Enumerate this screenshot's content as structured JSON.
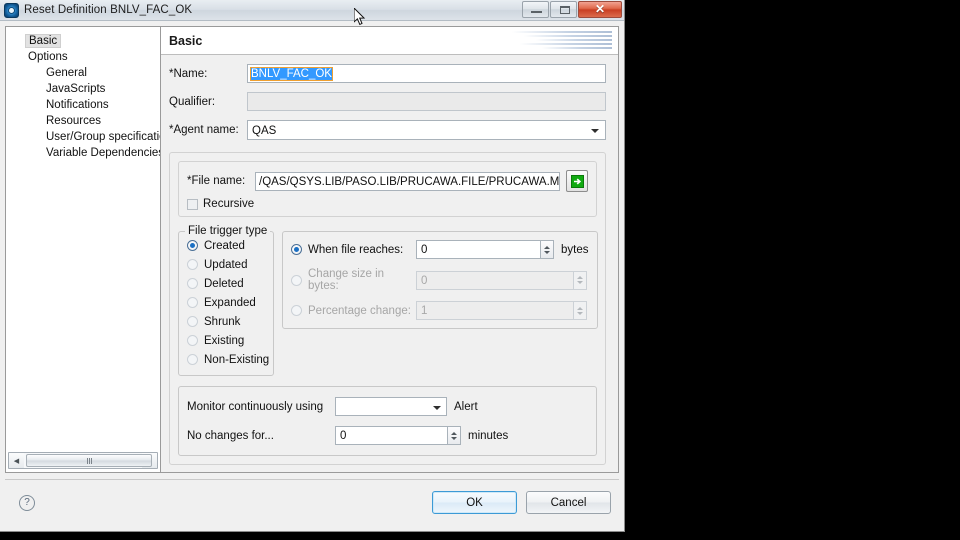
{
  "window": {
    "title": "Reset Definition BNLV_FAC_OK",
    "icon": "app-gear-icon",
    "minimize_label": "—",
    "maximize_label": "",
    "close_label": "✕"
  },
  "tree": {
    "items": [
      {
        "label": "Basic",
        "level": 0,
        "selected": true
      },
      {
        "label": "Options",
        "level": 0,
        "selected": false
      },
      {
        "label": "General",
        "level": 1,
        "selected": false
      },
      {
        "label": "JavaScripts",
        "level": 1,
        "selected": false
      },
      {
        "label": "Notifications",
        "level": 1,
        "selected": false
      },
      {
        "label": "Resources",
        "level": 1,
        "selected": false
      },
      {
        "label": "User/Group specificatio",
        "level": 1,
        "selected": false
      },
      {
        "label": "Variable Dependencies",
        "level": 1,
        "selected": false
      }
    ],
    "scrollbar": {
      "left_arrow": "◀",
      "right_arrow": "▶"
    }
  },
  "page": {
    "title": "Basic"
  },
  "form": {
    "name_label": "*Name:",
    "name_value": "BNLV_FAC_OK",
    "qualifier_label": "Qualifier:",
    "qualifier_value": "",
    "agent_label": "*Agent name:",
    "agent_value": "QAS"
  },
  "file_section": {
    "file_label": "*File name:",
    "file_value": "/QAS/QSYS.LIB/PASO.LIB/PRUCAWA.FILE/PRUCAWA.MBR",
    "browse_icon": "open-arrow-icon",
    "recursive_label": "Recursive",
    "recursive_checked": false
  },
  "trigger": {
    "legend": "File trigger type",
    "options": [
      {
        "label": "Created",
        "selected": true
      },
      {
        "label": "Updated",
        "selected": false
      },
      {
        "label": "Deleted",
        "selected": false
      },
      {
        "label": "Expanded",
        "selected": false
      },
      {
        "label": "Shrunk",
        "selected": false
      },
      {
        "label": "Existing",
        "selected": false
      },
      {
        "label": "Non-Existing",
        "selected": false
      }
    ]
  },
  "size_options": [
    {
      "label": "When file reaches:",
      "value": "0",
      "unit": "bytes",
      "selected": true,
      "enabled": true
    },
    {
      "label": "Change size in bytes:",
      "value": "0",
      "unit": "",
      "selected": false,
      "enabled": false
    },
    {
      "label": "Percentage change:",
      "value": "1",
      "unit": "",
      "selected": false,
      "enabled": false
    }
  ],
  "monitor": {
    "monitor_label": "Monitor continuously using",
    "monitor_value": "",
    "alert_label": "Alert",
    "nochanges_label": "No changes for...",
    "nochanges_value": "0",
    "minutes_label": "minutes"
  },
  "footer": {
    "help_label": "?",
    "ok_label": "OK",
    "cancel_label": "Cancel"
  },
  "colors": {
    "selection_blue": "#3399ff",
    "accent_green": "#00aa00",
    "close_red": "#c93f23",
    "default_button_border": "#3c9ad6"
  }
}
